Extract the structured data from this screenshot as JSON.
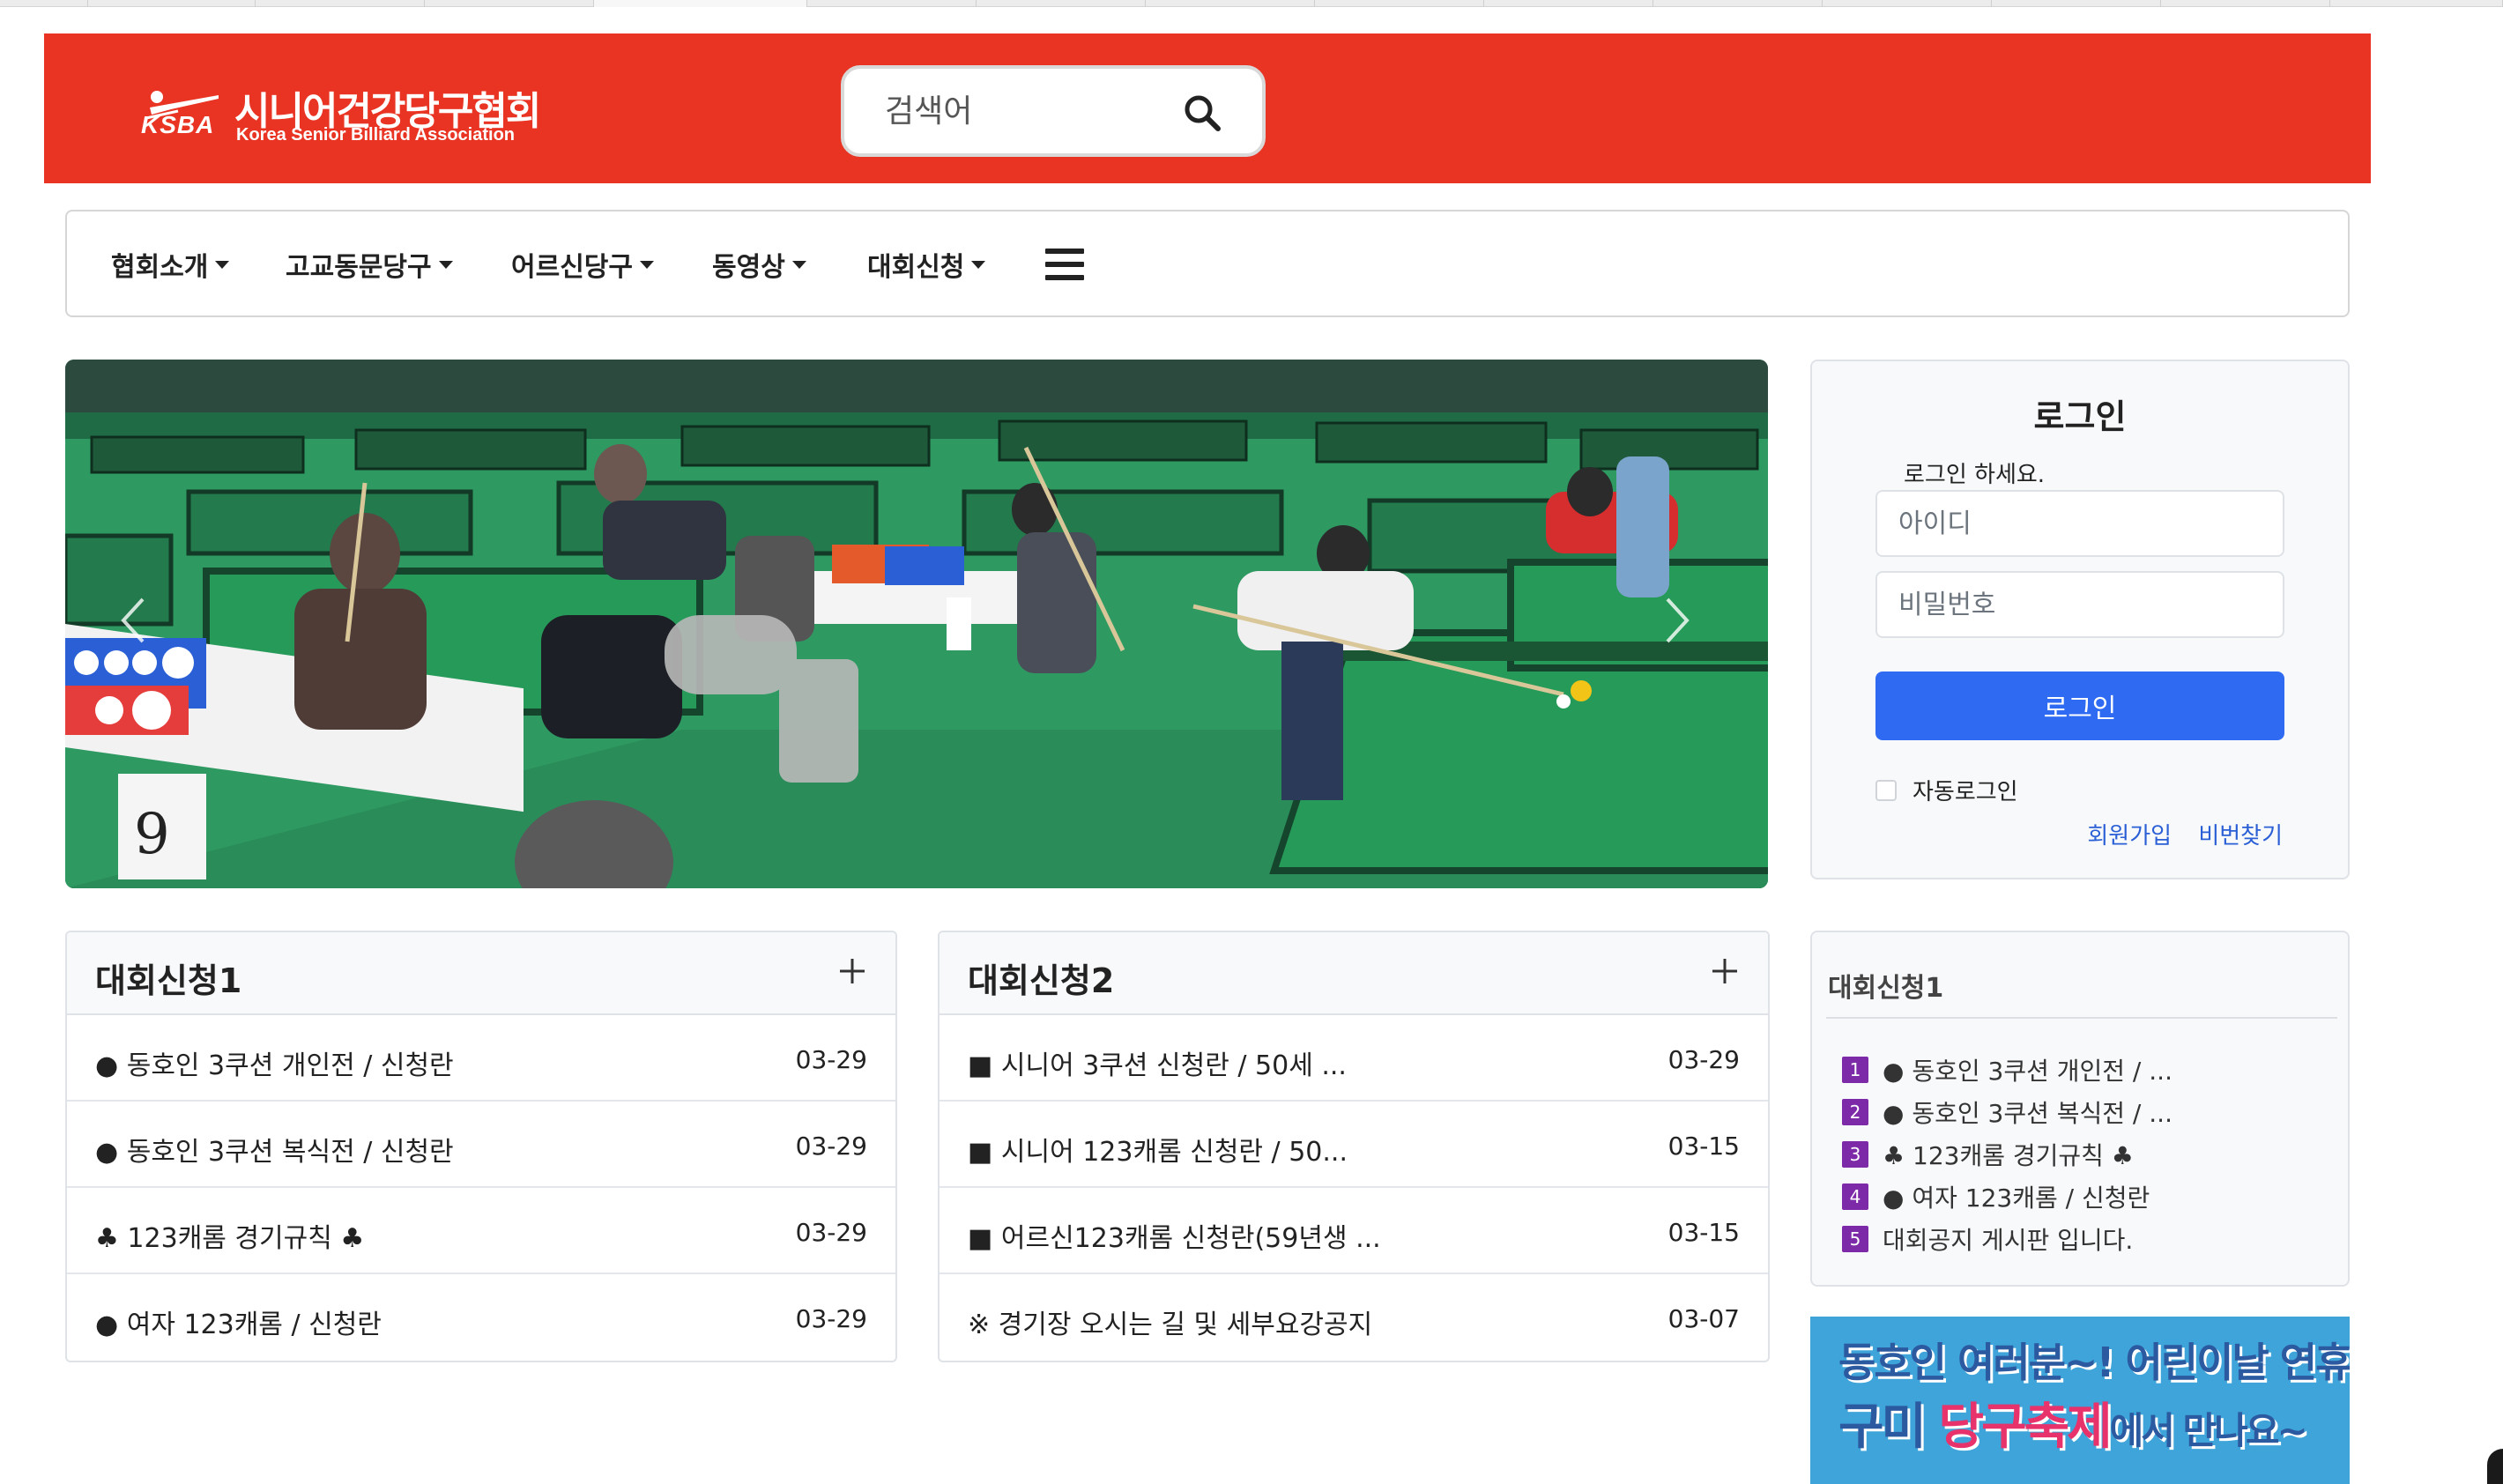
{
  "site": {
    "logo_mark": "KSBA",
    "logo_korean": "시니어건강당구협회",
    "logo_english": "Korea Senior Billiard Association",
    "brand_color": "#e93423"
  },
  "search": {
    "placeholder": "검색어",
    "icon": "search-icon"
  },
  "nav": {
    "items": [
      {
        "label": "협회소개"
      },
      {
        "label": "고교동문당구"
      },
      {
        "label": "어르신당구"
      },
      {
        "label": "동영상"
      },
      {
        "label": "대회신청"
      }
    ],
    "menu_icon": "hamburger-menu-icon"
  },
  "carousel": {
    "prev_icon": "chevron-left-icon",
    "next_icon": "chevron-right-icon"
  },
  "login": {
    "title": "로그인",
    "message": "로그인 하세요.",
    "id_placeholder": "아이디",
    "password_placeholder": "비밀번호",
    "button_label": "로그인",
    "button_color": "#2f6bf2",
    "auto_login_label": "자동로그인",
    "signup_label": "회원가입",
    "find_password_label": "비번찾기"
  },
  "boards": [
    {
      "title": "대회신청1",
      "more_icon": "plus-icon",
      "rows": [
        {
          "title": "● 동호인 3쿠션 개인전 / 신청란",
          "date": "03-29"
        },
        {
          "title": "● 동호인 3쿠션 복식전 / 신청란",
          "date": "03-29"
        },
        {
          "title": "♣ 123캐롬 경기규칙 ♣",
          "date": "03-29"
        },
        {
          "title": "● 여자 123캐롬 / 신청란",
          "date": "03-29"
        }
      ]
    },
    {
      "title": "대회신청2",
      "more_icon": "plus-icon",
      "rows": [
        {
          "title": "■ 시니어 3쿠션 신청란 / 50세 ...",
          "date": "03-29"
        },
        {
          "title": "■ 시니어 123캐롬 신청란 / 50...",
          "date": "03-15"
        },
        {
          "title": "■ 어르신123캐롬 신청란(59년생 ...",
          "date": "03-15"
        },
        {
          "title": "※ 경기장 오시는 길 및 세부요강공지",
          "date": "03-07"
        }
      ]
    }
  ],
  "side_list": {
    "title": "대회신청1",
    "badge_color": "#7d2aa8",
    "items": [
      {
        "num": "1",
        "text": "● 동호인 3쿠션 개인전 / ..."
      },
      {
        "num": "2",
        "text": "● 동호인 3쿠션 복식전 / ..."
      },
      {
        "num": "3",
        "text": "♣ 123캐롬 경기규칙 ♣"
      },
      {
        "num": "4",
        "text": "● 여자 123캐롬 / 신청란"
      },
      {
        "num": "5",
        "text": "대회공지 게시판 입니다."
      }
    ]
  },
  "banner": {
    "line1": "동호인 여러분~! 어린이날 연휴에",
    "line2_pre": "구미 ",
    "line2_highlight": "당구축제",
    "line2_post": "에서 만나요~"
  }
}
